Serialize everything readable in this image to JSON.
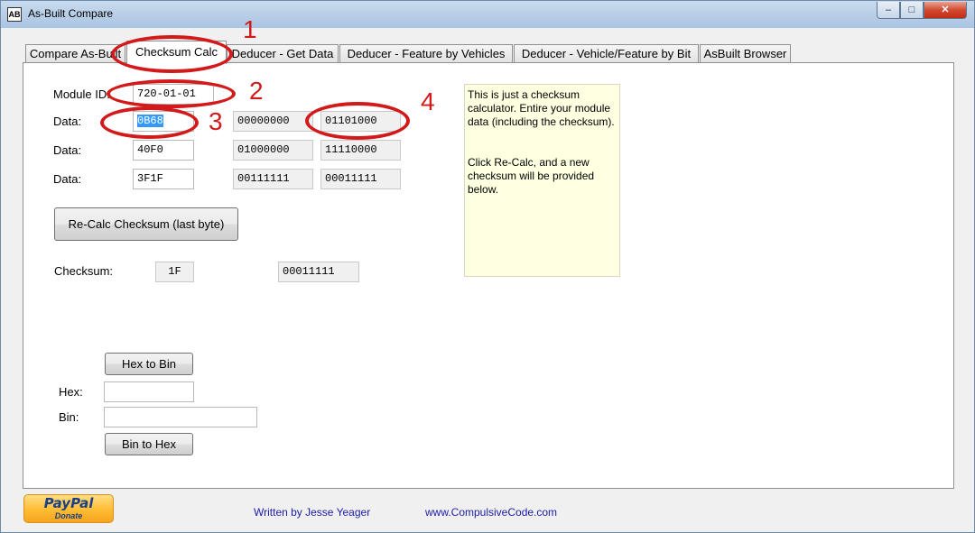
{
  "window": {
    "title": "As-Built Compare",
    "icon_text": "AB",
    "minimize": "–",
    "maximize": "□",
    "close": "✕"
  },
  "tabs": [
    {
      "label": "Compare As-Built"
    },
    {
      "label": "Checksum Calc"
    },
    {
      "label": "Deducer - Get Data"
    },
    {
      "label": "Deducer - Feature by Vehicles"
    },
    {
      "label": "Deducer - Vehicle/Feature by Bit"
    },
    {
      "label": "AsBuilt Browser"
    }
  ],
  "form": {
    "module_id_label": "Module ID:",
    "module_id_value": "720-01-01",
    "data_label": "Data:",
    "rows": [
      {
        "hex": "0B68",
        "bin1": "00000000",
        "bin2": "01101000"
      },
      {
        "hex": "40F0",
        "bin1": "01000000",
        "bin2": "11110000"
      },
      {
        "hex": "3F1F",
        "bin1": "00111111",
        "bin2": "00011111"
      }
    ],
    "recalc_button": "Re-Calc Checksum (last byte)",
    "checksum_label": "Checksum:",
    "checksum_hex": "1F",
    "checksum_bin": "00011111"
  },
  "info": {
    "para1": "This is just a checksum calculator.  Entire your module data (including the checksum).",
    "para2": "Click Re-Calc, and a new checksum will be provided below."
  },
  "converter": {
    "hex_to_bin_button": "Hex to Bin",
    "hex_label": "Hex:",
    "hex_value": "",
    "bin_label": "Bin:",
    "bin_value": "",
    "bin_to_hex_button": "Bin to Hex"
  },
  "annotations": {
    "n1": "1",
    "n2": "2",
    "n3": "3",
    "n4": "4",
    "color": "#d21a1a"
  },
  "footer": {
    "paypal_logo": "PayPal",
    "paypal_donate": "Donate",
    "author": "Written by Jesse Yeager",
    "website": "www.CompulsiveCode.com"
  }
}
